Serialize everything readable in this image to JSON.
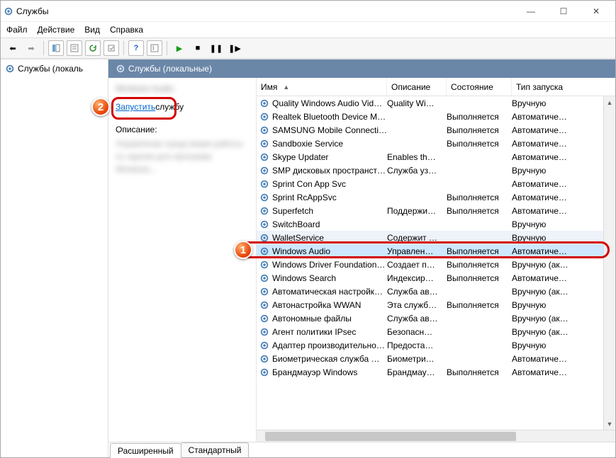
{
  "window": {
    "title": "Службы"
  },
  "menu": {
    "file": "Файл",
    "action": "Действие",
    "view": "Вид",
    "help": "Справка"
  },
  "left": {
    "node": "Службы (локаль"
  },
  "pane": {
    "title": "Службы (локальные)"
  },
  "detail": {
    "selected_name": "Windows Audio",
    "start_link": "Запустить",
    "start_suffix": " службу",
    "desc_label": "Описание:",
    "desc_text": "Управление средствами работы со звуком для программ Windows..."
  },
  "columns": {
    "name": "Имя",
    "desc": "Описание",
    "status": "Состояние",
    "startup": "Тип запуска"
  },
  "services": [
    {
      "name": "Quality Windows Audio Vid…",
      "desc": "Quality Wi…",
      "status": "",
      "startup": "Вручную"
    },
    {
      "name": "Realtek Bluetooth Device M…",
      "desc": "",
      "status": "Выполняется",
      "startup": "Автоматиче…"
    },
    {
      "name": "SAMSUNG Mobile Connecti…",
      "desc": "",
      "status": "Выполняется",
      "startup": "Автоматиче…"
    },
    {
      "name": "Sandboxie Service",
      "desc": "",
      "status": "Выполняется",
      "startup": "Автоматиче…"
    },
    {
      "name": "Skype Updater",
      "desc": "Enables th…",
      "status": "",
      "startup": "Автоматиче…"
    },
    {
      "name": "SMP дисковых пространст…",
      "desc": "Служба уз…",
      "status": "",
      "startup": "Вручную"
    },
    {
      "name": "Sprint Con App Svc",
      "desc": "",
      "status": "",
      "startup": "Автоматиче…"
    },
    {
      "name": "Sprint RcAppSvc",
      "desc": "",
      "status": "Выполняется",
      "startup": "Автоматиче…"
    },
    {
      "name": "Superfetch",
      "desc": "Поддержи…",
      "status": "Выполняется",
      "startup": "Автоматиче…"
    },
    {
      "name": "SwitchBoard",
      "desc": "",
      "status": "",
      "startup": "Вручную"
    },
    {
      "name": "WalletService",
      "desc": "Содержит …",
      "status": "",
      "startup": "Вручную",
      "wallet": true
    },
    {
      "name": "Windows Audio",
      "desc": "Управлен…",
      "status": "Выполняется",
      "startup": "Автоматиче…",
      "selected": true
    },
    {
      "name": "Windows Driver Foundation…",
      "desc": "Создает п…",
      "status": "Выполняется",
      "startup": "Вручную (ак…"
    },
    {
      "name": "Windows Search",
      "desc": "Индексир…",
      "status": "Выполняется",
      "startup": "Автоматиче…"
    },
    {
      "name": "Автоматическая настройк…",
      "desc": "Служба ав…",
      "status": "",
      "startup": "Вручную (ак…"
    },
    {
      "name": "Автонастройка WWAN",
      "desc": "Эта служб…",
      "status": "Выполняется",
      "startup": "Вручную"
    },
    {
      "name": "Автономные файлы",
      "desc": "Служба ав…",
      "status": "",
      "startup": "Вручную (ак…"
    },
    {
      "name": "Агент политики IPsec",
      "desc": "Безопасн…",
      "status": "",
      "startup": "Вручную (ак…"
    },
    {
      "name": "Адаптер производительно…",
      "desc": "Предоста…",
      "status": "",
      "startup": "Вручную"
    },
    {
      "name": "Биометрическая служба …",
      "desc": "Биометри…",
      "status": "",
      "startup": "Автоматиче…"
    },
    {
      "name": "Брандмауэр Windows",
      "desc": "Брандмау…",
      "status": "Выполняется",
      "startup": "Автоматиче…"
    }
  ],
  "tabs": {
    "extended": "Расширенный",
    "standard": "Стандартный"
  },
  "callouts": {
    "c1": "1",
    "c2": "2"
  }
}
